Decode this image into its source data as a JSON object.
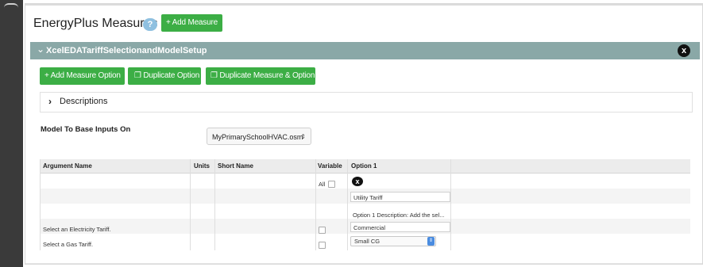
{
  "header": {
    "title": "EnergyPlus Measures",
    "info_icon": "?",
    "add_measure_label": "+ Add Measure"
  },
  "measure": {
    "name": "XcelEDATariffSelectionandModelSetup",
    "close_icon": "x",
    "buttons": {
      "add_option": "+ Add Measure Option",
      "duplicate_option": "Duplicate Option",
      "duplicate_measure_option": "Duplicate Measure & Option"
    },
    "descriptions_label": "Descriptions",
    "model_label": "Model To Base Inputs On",
    "model_selected": "MyPrimarySchoolHVAC.osm"
  },
  "table": {
    "headers": [
      "Argument Name",
      "Units",
      "Short Name",
      "Variable",
      "Option 1"
    ],
    "all_label": "All",
    "option_close_icon": "x",
    "option_name": "Utility Tariff",
    "option_description": "Option 1 Description: Add the sel...",
    "rows": [
      {
        "argument": "Select an Electricity Tariff.",
        "value": "Commercial"
      },
      {
        "argument": "Select a Gas Tariff.",
        "value": "Small CG"
      }
    ]
  },
  "colors": {
    "green": "#3cae45",
    "measure_bar": "#8aa8a7",
    "info": "#8fc0e0",
    "select_blue": "#4a8ce0"
  }
}
